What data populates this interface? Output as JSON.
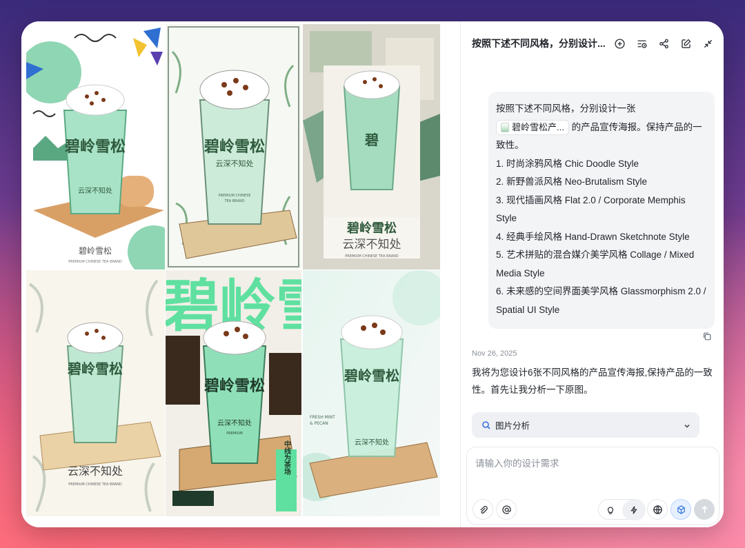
{
  "chat": {
    "title": "按照下述不同风格，分别设计...",
    "user_message": {
      "line_intro": "按照下述不同风格，分别设计一张",
      "chip_label": "碧岭雪松产...",
      "line_after_chip": "的产品宣传海报。保持产品的一致性。",
      "styles": [
        "1. 时尚涂鸦风格 Chic Doodle Style",
        "2. 新野兽派风格 Neo-Brutalism Style",
        "3. 现代插画风格 Flat 2.0 / Corporate Memphis Style",
        "4. 经典手绘风格 Hand-Drawn Sketchnote Style",
        "5. 艺术拼贴的混合媒介美学风格 Collage / Mixed Media Style",
        "6. 未来感的空间界面美学风格 Glassmorphism 2.0 / Spatial UI Style"
      ]
    },
    "timestamp": "Nov 26, 2025",
    "ai_message": "我将为您设计6张不同风格的产品宣传海报,保持产品的一致性。首先让我分析一下原图。",
    "analysis_label": "图片分析",
    "input_placeholder": "请输入你的设计需求"
  },
  "posters": {
    "p1": {
      "title": "碧岭雪松",
      "slogan": "云深不知处",
      "brand_cn": "碧岭雪松",
      "brand_en": "PREMIUM CHINESE TEA BRAND"
    },
    "p2": {
      "title": "碧岭雪松",
      "slogan": "云深不知处",
      "en1": "PREMIUM CHINESE",
      "en2": "TEA BRAND"
    },
    "p3": {
      "title": "碧岭雪松",
      "slogan": "云深不知处",
      "brand_cn": "碧岭雪松",
      "brand_en": "PREMIUM CHINESE TEA BRAND"
    },
    "p4": {
      "title": "碧岭雪松",
      "slogan": "云深不知处",
      "brand_en": "PREMIUM CHINESE TEA BRAND"
    },
    "p5": {
      "title": "碧岭雪松",
      "bg_text": "碧岭雪松",
      "slogan": "云深不知处",
      "side_text": "中线为茶场",
      "en": "PREMIUM"
    },
    "p6": {
      "title": "碧岭雪松",
      "slogan": "云深不知处",
      "tag1": "FRESH MINT",
      "tag2": "& PECAN"
    }
  },
  "icons": {
    "header": [
      "plus-circle-icon",
      "history-icon",
      "share-icon",
      "edit-icon",
      "collapse-icon"
    ],
    "toolbar": [
      "paperclip-icon",
      "at-icon",
      "bulb-icon",
      "lightning-icon",
      "globe-icon",
      "cube-icon",
      "send-icon"
    ]
  },
  "colors": {
    "mint": "#8fd6b4",
    "dark_green": "#2f5a3d",
    "accent_blue": "#3b7be0"
  }
}
